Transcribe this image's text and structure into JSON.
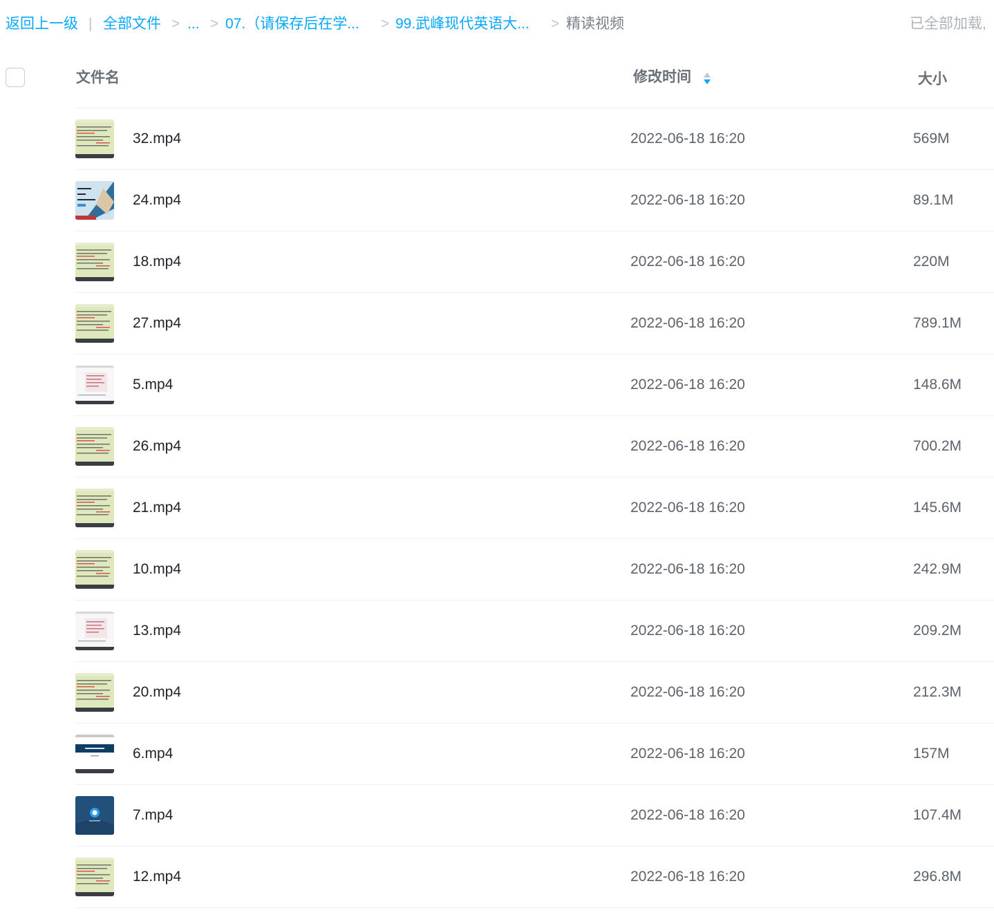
{
  "breadcrumb": {
    "back": "返回上一级",
    "divider": "|",
    "all_files": "全部文件",
    "sep": ">",
    "ellipsis": "...",
    "folder1": "07.（请保存后在学...",
    "folder2": "99.武峰现代英语大...",
    "current": "精读视频",
    "status": "已全部加载,"
  },
  "columns": {
    "name": "文件名",
    "modified": "修改时间",
    "size": "大小"
  },
  "files": [
    {
      "name": "32.mp4",
      "date": "2022-06-18 16:20",
      "size": "569M",
      "thumb": "green-doc"
    },
    {
      "name": "24.mp4",
      "date": "2022-06-18 16:20",
      "size": "89.1M",
      "thumb": "blue-slide"
    },
    {
      "name": "18.mp4",
      "date": "2022-06-18 16:20",
      "size": "220M",
      "thumb": "green-doc"
    },
    {
      "name": "27.mp4",
      "date": "2022-06-18 16:20",
      "size": "789.1M",
      "thumb": "green-doc"
    },
    {
      "name": "5.mp4",
      "date": "2022-06-18 16:20",
      "size": "148.6M",
      "thumb": "white-doc"
    },
    {
      "name": "26.mp4",
      "date": "2022-06-18 16:20",
      "size": "700.2M",
      "thumb": "green-doc"
    },
    {
      "name": "21.mp4",
      "date": "2022-06-18 16:20",
      "size": "145.6M",
      "thumb": "green-doc"
    },
    {
      "name": "10.mp4",
      "date": "2022-06-18 16:20",
      "size": "242.9M",
      "thumb": "green-doc"
    },
    {
      "name": "13.mp4",
      "date": "2022-06-18 16:20",
      "size": "209.2M",
      "thumb": "white-doc"
    },
    {
      "name": "20.mp4",
      "date": "2022-06-18 16:20",
      "size": "212.3M",
      "thumb": "green-doc"
    },
    {
      "name": "6.mp4",
      "date": "2022-06-18 16:20",
      "size": "157M",
      "thumb": "navy-banner"
    },
    {
      "name": "7.mp4",
      "date": "2022-06-18 16:20",
      "size": "107.4M",
      "thumb": "blue-app"
    },
    {
      "name": "12.mp4",
      "date": "2022-06-18 16:20",
      "size": "296.8M",
      "thumb": "green-doc"
    }
  ],
  "colors": {
    "link": "#06a7ff",
    "separator": "#c0c4cc",
    "sort_active": "#06a7ff",
    "sort_inactive": "#c0c4cc"
  }
}
